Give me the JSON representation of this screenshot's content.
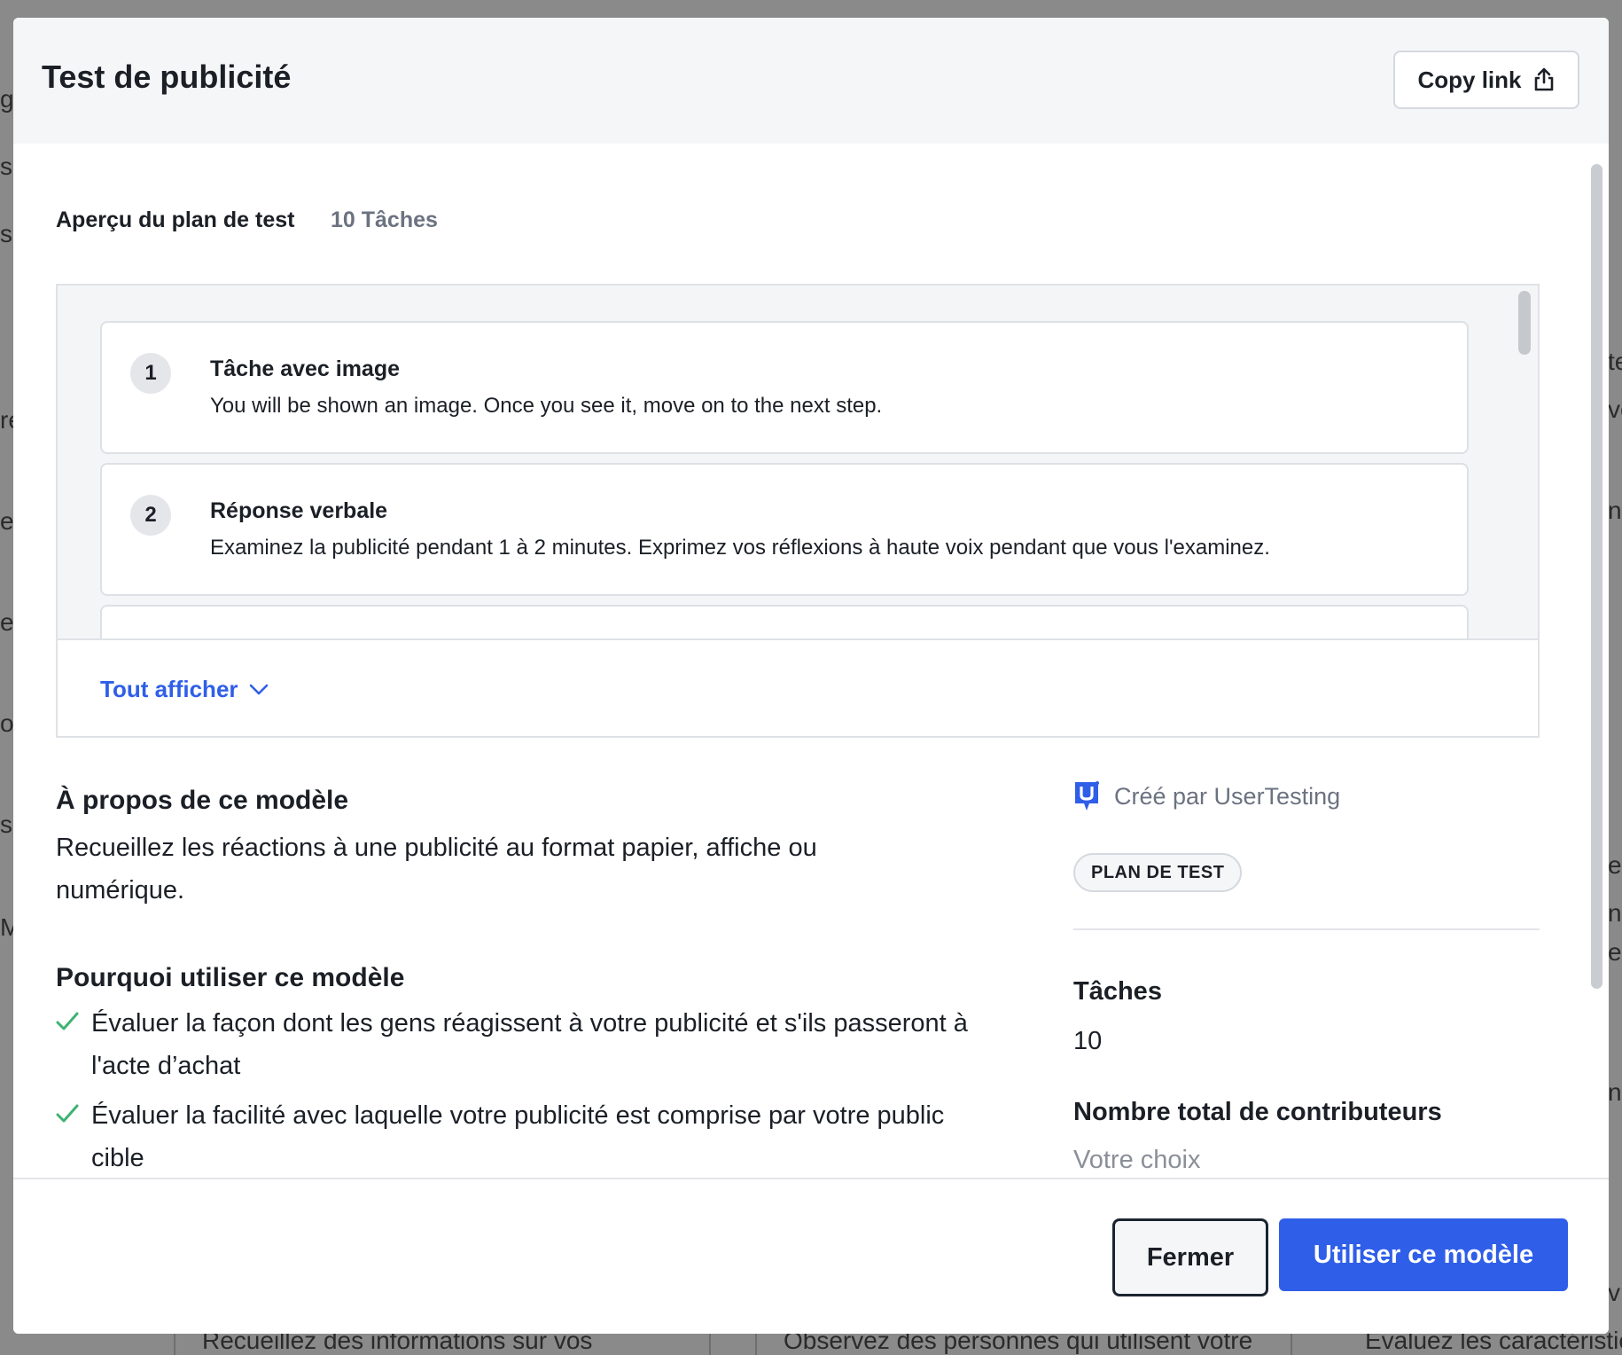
{
  "background": {
    "fragments": [
      "g",
      "s",
      "s",
      "re",
      "es",
      "e",
      "ot",
      "si",
      "M",
      "te",
      "ve",
      "n",
      "ep",
      "n",
      "e",
      "n",
      "v"
    ],
    "bottom_texts": [
      "Recueillez des informations sur vos",
      "Observez des personnes qui utilisent votre",
      "Évaluez les caractéristic"
    ]
  },
  "modal": {
    "title": "Test de publicité",
    "copy_link_label": "Copy link"
  },
  "preview": {
    "heading": "Aperçu du plan de test",
    "count": "10 Tâches",
    "tasks": [
      {
        "number": "1",
        "title": "Tâche avec image",
        "description": "You will be shown an image. Once you see it, move on to the next step."
      },
      {
        "number": "2",
        "title": "Réponse verbale",
        "description": "Examinez la publicité pendant 1 à 2 minutes. Exprimez vos réflexions à haute voix pendant que vous l'examinez."
      }
    ],
    "show_all_label": "Tout afficher"
  },
  "about": {
    "title": "À propos de ce modèle",
    "text": "Recueillez les réactions à une publicité au format papier, affiche ou numérique."
  },
  "why": {
    "title": "Pourquoi utiliser ce modèle",
    "items": [
      "Évaluer la façon dont les gens réagissent à votre publicité et s'ils passeront à l'acte d’achat",
      "Évaluer la facilité avec laquelle votre publicité est comprise par votre public cible"
    ]
  },
  "sidebar": {
    "creator": "Créé par UserTesting",
    "tag": "PLAN DE TEST",
    "tasks_label": "Tâches",
    "tasks_value": "10",
    "contributors_label": "Nombre total de contributeurs",
    "contributors_value": "Votre choix"
  },
  "footer": {
    "close_label": "Fermer",
    "use_label": "Utiliser ce modèle"
  },
  "colors": {
    "accent": "#2f5ee8",
    "check": "#3cb371",
    "muted": "#6b7280"
  },
  "icons": [
    "share-icon",
    "chevron-down-icon",
    "check-icon",
    "usertesting-logo-icon"
  ]
}
